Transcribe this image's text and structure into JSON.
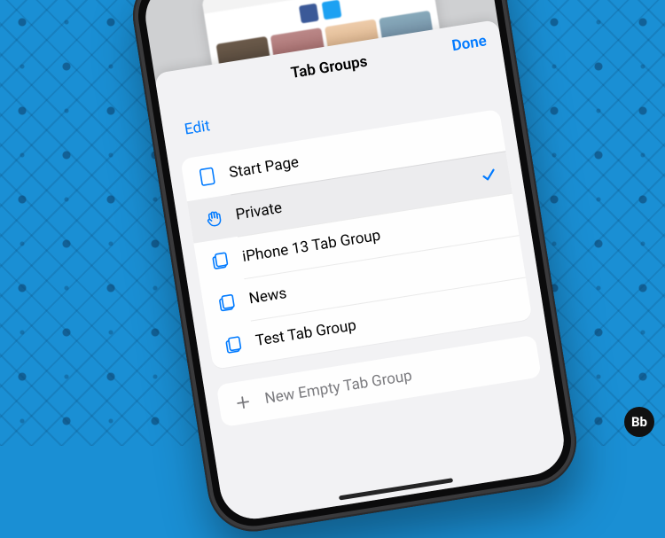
{
  "colors": {
    "ios_blue": "#007aff",
    "sheet_bg": "#f2f2f4"
  },
  "sheet": {
    "title": "Tab Groups",
    "done": "Done",
    "edit": "Edit"
  },
  "groups": [
    {
      "label": "Start Page",
      "icon": "tab-icon",
      "selected": false
    },
    {
      "label": "Private",
      "icon": "hand-icon",
      "selected": true
    },
    {
      "label": "iPhone 13 Tab Group",
      "icon": "tabs-icon",
      "selected": false
    },
    {
      "label": "News",
      "icon": "tabs-icon",
      "selected": false
    },
    {
      "label": "Test Tab Group",
      "icon": "tabs-icon",
      "selected": false
    }
  ],
  "new_group": {
    "label": "New Empty Tab Group"
  },
  "watermark": "Bb"
}
